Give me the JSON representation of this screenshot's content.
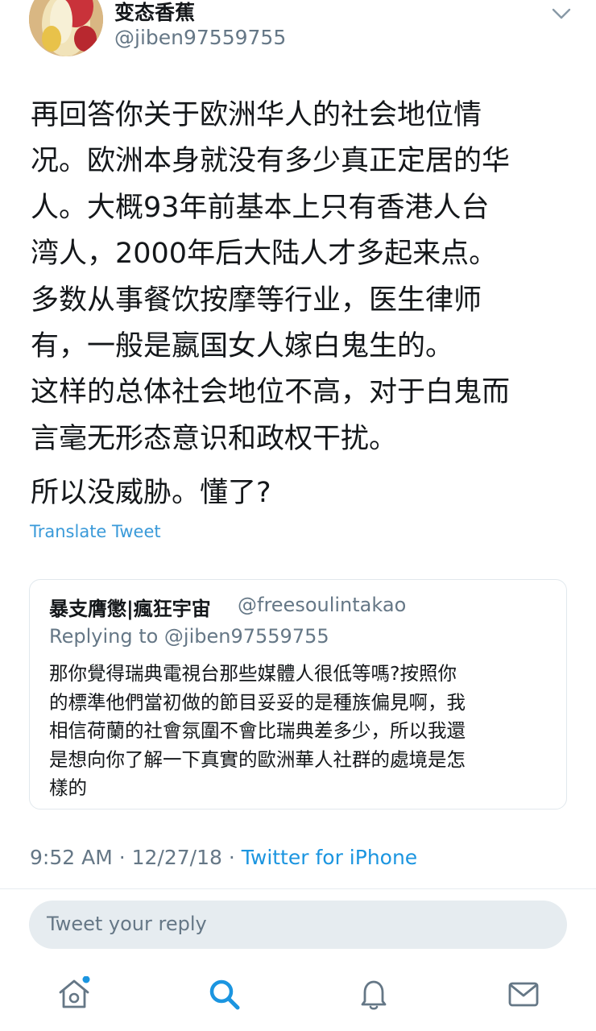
{
  "author": {
    "name": "变态香蕉",
    "handle": "@jiben97559755",
    "avatar_icon": "banana-avatar-icon"
  },
  "tweet": {
    "lines": [
      "再回答你关于欧洲华人的社会地位情",
      "况。欧洲本身就没有多少真正定居的华",
      "人。大概93年前基本上只有香港人台",
      "湾人，2000年后大陆人才多起来点。",
      "多数从事餐饮按摩等行业，医生律师",
      "有，一般是嬴国女人嫁白鬼生的。",
      "这样的总体社会地位不高，对于白鬼而",
      "言毫无形态意识和政权干扰。"
    ],
    "closing": "所以没威胁。懂了?",
    "translate_label": "Translate Tweet"
  },
  "quoted_tweet": {
    "name": "暴支膺懲|瘋狂宇宙",
    "handle": "@freesoulintakao",
    "replying_to": "Replying to @jiben97559755",
    "lines": [
      "那你覺得瑞典電視台那些媒體人很低等嗎?按照你",
      "的標準他們當初做的節目妥妥的是種族偏見啊，我",
      "相信荷蘭的社會氛圍不會比瑞典差多少，所以我還",
      "是想向你了解一下真實的歐洲華人社群的處境是怎",
      "樣的"
    ]
  },
  "meta": {
    "time": "9:52 AM",
    "date": "12/27/18",
    "separator": " · ",
    "source": "Twitter for iPhone"
  },
  "reply": {
    "placeholder": "Tweet your reply"
  },
  "tab_bar": {
    "items": [
      "home-icon",
      "search-icon",
      "notifications-bell-icon",
      "messages-envelope-icon"
    ],
    "active": "search-icon",
    "notification_dot_on": "home-icon"
  },
  "colors": {
    "accent": "#1b95e0",
    "translate": "#3a9ad9",
    "secondary_text": "#657786",
    "primary_text": "#14171a",
    "border": "#e1e8ed",
    "reply_bg": "#e6ecf0",
    "inactive_icon": "#657786"
  }
}
